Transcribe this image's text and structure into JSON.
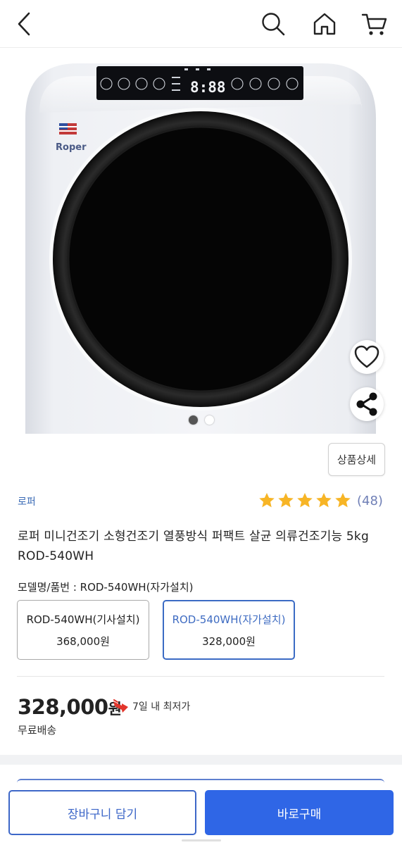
{
  "header": {
    "back_icon": "chevron-left-icon",
    "search_icon": "search-icon",
    "home_icon": "home-icon",
    "cart_icon": "cart-icon"
  },
  "hero": {
    "product_image": "mini-dryer-photo",
    "brand_logo_text": "Roper",
    "display_text": "8:88",
    "slide_count": 2,
    "active_slide": 1
  },
  "actions": {
    "wishlist_icon": "heart-icon",
    "share_icon": "share-icon",
    "detail_button": "상품상세"
  },
  "product": {
    "brand": "로퍼",
    "rating_stars": 5,
    "review_count": "(48)",
    "title": "로퍼 미니건조기 소형건조기 열풍방식 퍼팩트 살균 의류건조기능 5kg ROD-540WH",
    "model_label": "모델명/품번 : ROD-540WH(자가설치)",
    "options": [
      {
        "name": "ROD-540WH(기사설치)",
        "price": "368,000원",
        "selected": false
      },
      {
        "name": "ROD-540WH(자가설치)",
        "price": "328,000원",
        "selected": true
      }
    ],
    "price_number": "328,000",
    "price_unit": "원",
    "lowest_badge": "7일 내 최저가",
    "shipping": "무료배송"
  },
  "bottom": {
    "cart_button": "장바구니 담기",
    "buy_button": "바로구매"
  },
  "colors": {
    "accent": "#2f66e6",
    "star": "#f7b526",
    "brand_text": "#3a6ab5",
    "selected_option_border": "#3b6bc4"
  }
}
